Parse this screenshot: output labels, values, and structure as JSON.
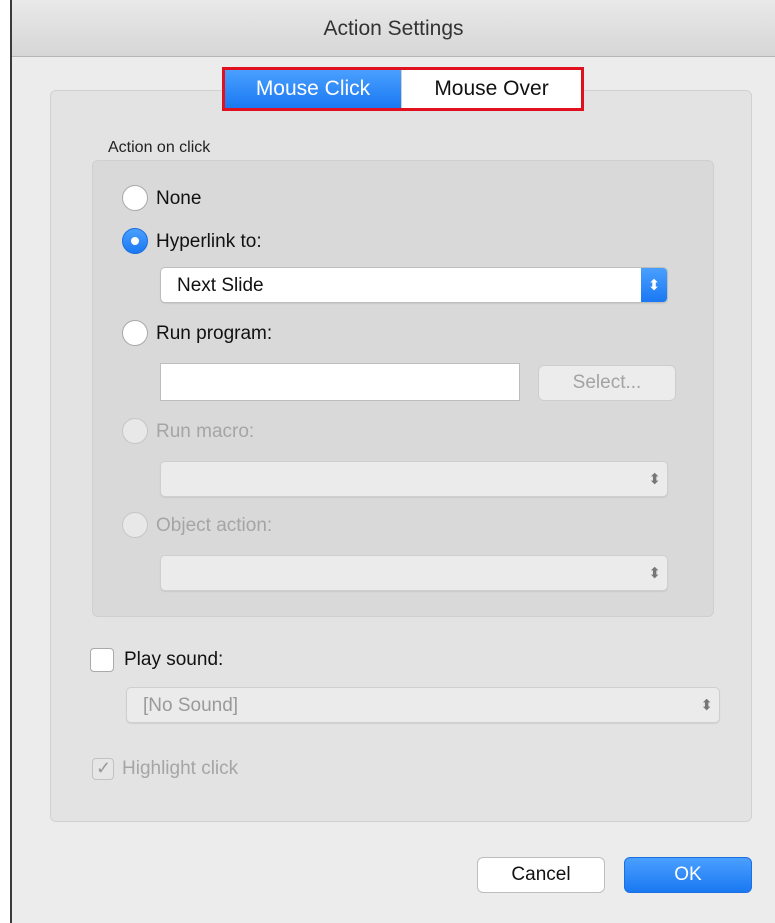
{
  "window": {
    "title": "Action Settings"
  },
  "tabs": [
    {
      "label": "Mouse Click",
      "active": true
    },
    {
      "label": "Mouse Over",
      "active": false
    }
  ],
  "action_on_click": {
    "section_label": "Action on click",
    "options": {
      "none": {
        "label": "None",
        "selected": false,
        "enabled": true
      },
      "hyperlink": {
        "label": "Hyperlink to:",
        "selected": true,
        "enabled": true,
        "value": "Next Slide"
      },
      "run_program": {
        "label": "Run program:",
        "selected": false,
        "enabled": true,
        "value": "",
        "select_button": "Select..."
      },
      "run_macro": {
        "label": "Run macro:",
        "selected": false,
        "enabled": false,
        "value": ""
      },
      "object_action": {
        "label": "Object action:",
        "selected": false,
        "enabled": false,
        "value": ""
      }
    }
  },
  "play_sound": {
    "label": "Play sound:",
    "checked": false,
    "value": "[No Sound]"
  },
  "highlight_click": {
    "label": "Highlight click",
    "checked": true,
    "enabled": false
  },
  "buttons": {
    "cancel": "Cancel",
    "ok": "OK"
  },
  "icons": {
    "stepper": "up-down-chevron-icon",
    "check": "checkmark-icon"
  },
  "colors": {
    "accent": "#1a78f2",
    "highlight_border": "#e0101e"
  }
}
